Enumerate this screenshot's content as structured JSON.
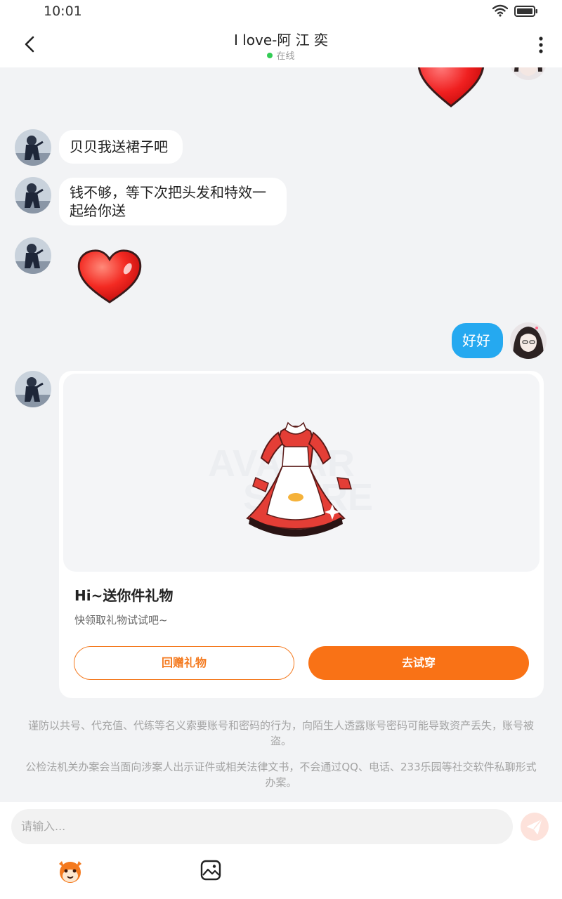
{
  "status_bar": {
    "time": "10:01",
    "icons": [
      "wifi-icon",
      "battery-icon"
    ]
  },
  "header": {
    "title": "I love-阿 江 奕",
    "status": "在线",
    "status_color": "#33cc55"
  },
  "messages": [
    {
      "side": "left",
      "type": "text",
      "text": "贝贝我送裙子吧"
    },
    {
      "side": "left",
      "type": "text",
      "lines": [
        "钱不够，等下次把头发和特效一",
        "起给你送"
      ]
    },
    {
      "side": "left",
      "type": "sticker",
      "sticker": "heart-sticker"
    },
    {
      "side": "right",
      "type": "text",
      "text": "好好"
    }
  ],
  "gift_card": {
    "title": "Hi~送你件礼物",
    "subtitle": "快领取礼物试试吧~",
    "return_label": "回赠礼物",
    "try_label": "去试穿",
    "watermark": "AVATAR STORE"
  },
  "notices": [
    "谨防以共号、代充值、代练等名义索要账号和密码的行为，向陌生人透露账号密码可能导致资产丢失，账号被盗。",
    "公检法机关办案会当面向涉案人出示证件或相关法律文书，不会通过QQ、电话、233乐园等社交软件私聊形式办案。"
  ],
  "composer": {
    "placeholder": "请输入..."
  },
  "colors": {
    "accent": "#f97216",
    "my_bubble": "#25a9f0",
    "background": "#f2f3f5"
  }
}
